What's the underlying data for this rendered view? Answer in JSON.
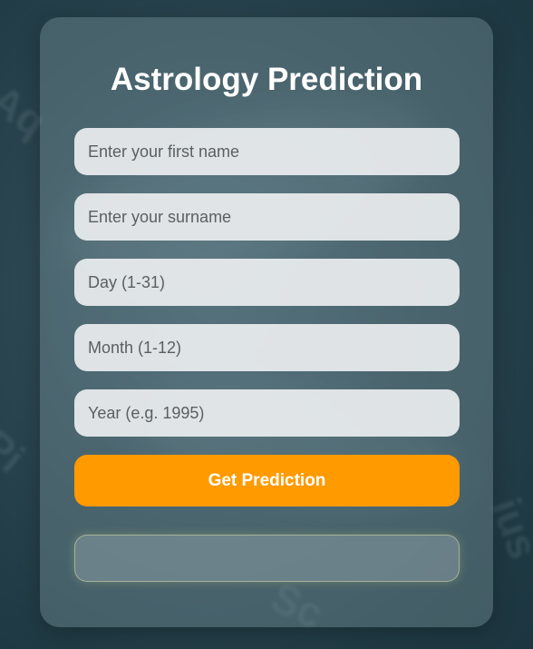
{
  "form": {
    "title": "Astrology Prediction",
    "fields": {
      "first_name": {
        "value": "",
        "placeholder": "Enter your first name"
      },
      "surname": {
        "value": "",
        "placeholder": "Enter your surname"
      },
      "day": {
        "value": "",
        "placeholder": "Day (1-31)"
      },
      "month": {
        "value": "",
        "placeholder": "Month (1-12)"
      },
      "year": {
        "value": "",
        "placeholder": "Year (e.g. 1995)"
      }
    },
    "submit_label": "Get Prediction",
    "result_text": ""
  },
  "theme": {
    "accent": "#ff9a00",
    "background": "#2a4550"
  }
}
